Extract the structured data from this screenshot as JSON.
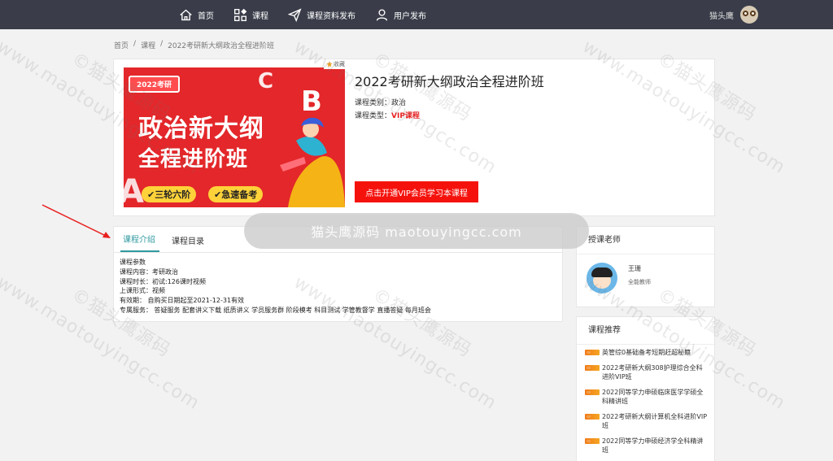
{
  "nav": {
    "items": [
      {
        "label": "首页",
        "icon": "home-icon"
      },
      {
        "label": "课程",
        "icon": "grid-icon"
      },
      {
        "label": "课程资料发布",
        "icon": "send-icon"
      },
      {
        "label": "用户发布",
        "icon": "user-icon"
      }
    ],
    "username": "猫头鹰"
  },
  "breadcrumb": {
    "home": "首页",
    "sep": "/",
    "category": "课程",
    "current": "2022考研新大纲政治全程进阶班"
  },
  "course": {
    "fav_label": "收藏",
    "banner": {
      "tag": "2022考研",
      "line1": "政治新大纲",
      "line2": "全程进阶班",
      "pill1": "✔三轮六阶",
      "pill2": "✔急速备考"
    },
    "title": "2022考研新大纲政治全程进阶班",
    "category_label": "课程类别：",
    "category_value": "政治",
    "type_label": "课程类型：",
    "type_value": "VIP课程",
    "vip_button": "点击开通VIP会员学习本课程"
  },
  "tabs": {
    "intro": "课程介绍",
    "catalog": "课程目录"
  },
  "params": [
    "课程参数",
    "课程内容：考研政治",
    "课程时长：初试:126课时视频",
    "上课形式：视频",
    "有效期：   自购买日期起至2021-12-31有效",
    "专属服务：  答疑服务 配套讲义下载 纸质讲义 学员服务群 阶段模考 科目测试 学管教督学 直播答疑 每月班会"
  ],
  "teacher": {
    "title": "授课老师",
    "name": "王珊",
    "role": "全能教师"
  },
  "recommend": {
    "title": "课程推荐",
    "items": [
      "英管综0基础备考短期赶超秘籍",
      "2022考研新大纲308护理综合全科进阶VIP班",
      "2022同等学力申硕临床医学学硕全科精讲班",
      "2022考研新大纲计算机全科进阶VIP班",
      "2022同等学力申硕经济学全科精讲班"
    ]
  },
  "watermark": {
    "text1": "©猫头鹰源码",
    "text2": "www.maotouyingcc.com",
    "band": "猫头鹰源码 maotouyingcc.com"
  },
  "colors": {
    "topbar": "#3a3d49",
    "accent_red": "#f5120d",
    "tab_active": "#2f9aa0"
  }
}
